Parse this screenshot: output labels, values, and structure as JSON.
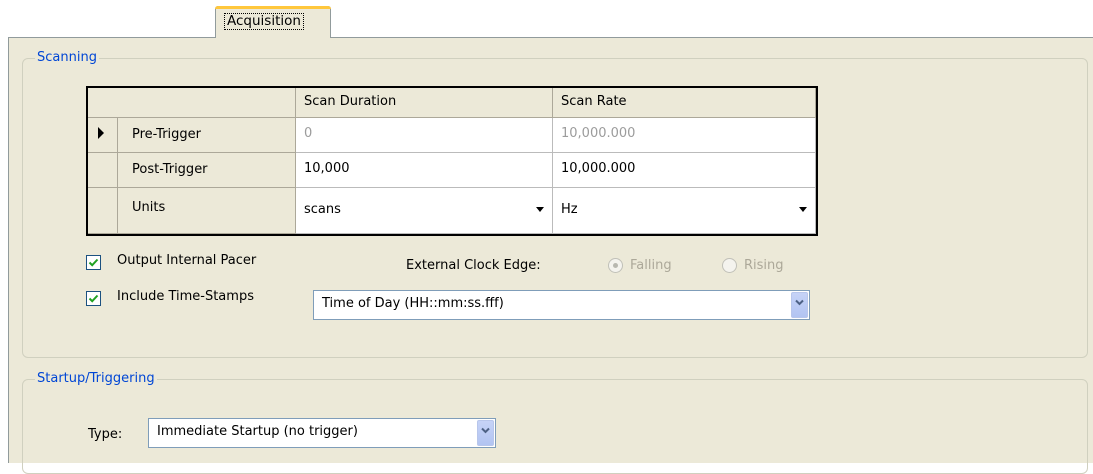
{
  "tab": {
    "label": "Acquisition"
  },
  "scanning": {
    "title": "Scanning",
    "grid": {
      "headers": [
        "Scan Duration",
        "Scan Rate"
      ],
      "rows": [
        {
          "label": "Pre-Trigger",
          "duration": "0",
          "rate": "10,000.000"
        },
        {
          "label": "Post-Trigger",
          "duration": "10,000",
          "rate": "10,000.000"
        },
        {
          "label": "Units",
          "duration": "scans",
          "rate": "Hz"
        }
      ]
    },
    "output_internal_pacer": {
      "label": "Output Internal Pacer",
      "checked": true
    },
    "external_clock_edge": {
      "label": "External Clock Edge:",
      "options": [
        "Falling",
        "Rising"
      ],
      "selected": "Falling"
    },
    "include_time_stamps": {
      "label": "Include Time-Stamps",
      "checked": true
    },
    "time_format": {
      "value": "Time of Day (HH::mm:ss.fff)"
    }
  },
  "startup": {
    "title": "Startup/Triggering",
    "type_label": "Type:",
    "type_value": "Immediate Startup (no trigger)"
  },
  "colors": {
    "accent": "#0046d5",
    "panel": "#ece9d8",
    "tab_highlight": "#ffc73c"
  }
}
